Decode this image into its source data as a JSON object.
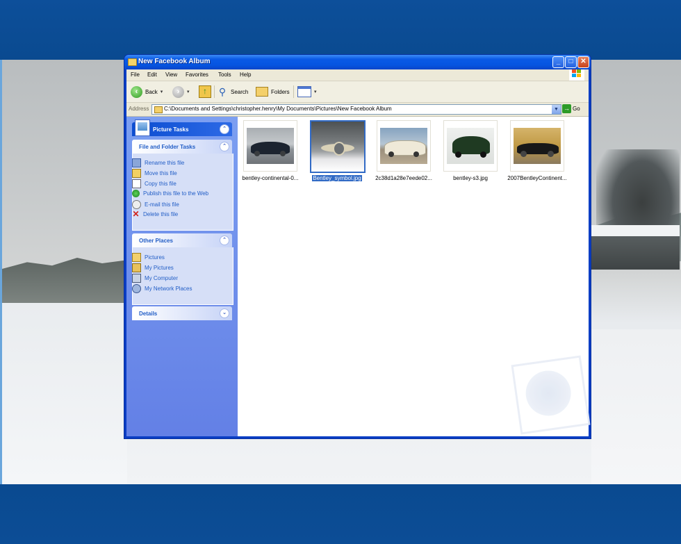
{
  "window": {
    "title": "New Facebook Album",
    "minimize": "_",
    "maximize": "□",
    "close": "✕"
  },
  "menu": [
    "File",
    "Edit",
    "View",
    "Favorites",
    "Tools",
    "Help"
  ],
  "toolbar": {
    "back": "Back",
    "search": "Search",
    "folders": "Folders"
  },
  "address": {
    "label": "Address",
    "path": "C:\\Documents and Settings\\christopher.henry\\My Documents\\Pictures\\New Facebook Album",
    "go": "Go"
  },
  "taskpane": {
    "picture_tasks": "Picture Tasks",
    "file_folder_tasks": {
      "title": "File and Folder Tasks",
      "items": [
        "Rename this file",
        "Move this file",
        "Copy this file",
        "Publish this file to the Web",
        "E-mail this file",
        "Delete this file"
      ]
    },
    "other_places": {
      "title": "Other Places",
      "items": [
        "Pictures",
        "My Pictures",
        "My Computer",
        "My Network Places"
      ]
    },
    "details": {
      "title": "Details"
    }
  },
  "files": [
    {
      "name": "bentley-continental-0...",
      "selected": false,
      "colors": [
        "#9aa1a5",
        "#1c2430"
      ]
    },
    {
      "name": "Bentley_symbol.jpg",
      "selected": true,
      "colors": [
        "#5a5d5f",
        "#d8d0b8"
      ]
    },
    {
      "name": "2c38d1a28e7eede02...",
      "selected": false,
      "colors": [
        "#7e9bb8",
        "#efe9d8"
      ]
    },
    {
      "name": "bentley-s3.jpg",
      "selected": false,
      "colors": [
        "#e9ece9",
        "#1f3a22"
      ]
    },
    {
      "name": "2007BentleyContinent...",
      "selected": false,
      "colors": [
        "#caa04a",
        "#181818"
      ]
    }
  ],
  "icons": {
    "back": "back-arrow-icon",
    "forward": "forward-arrow-icon",
    "up": "up-folder-icon",
    "search": "search-icon",
    "folders": "folders-icon",
    "views": "views-icon"
  }
}
